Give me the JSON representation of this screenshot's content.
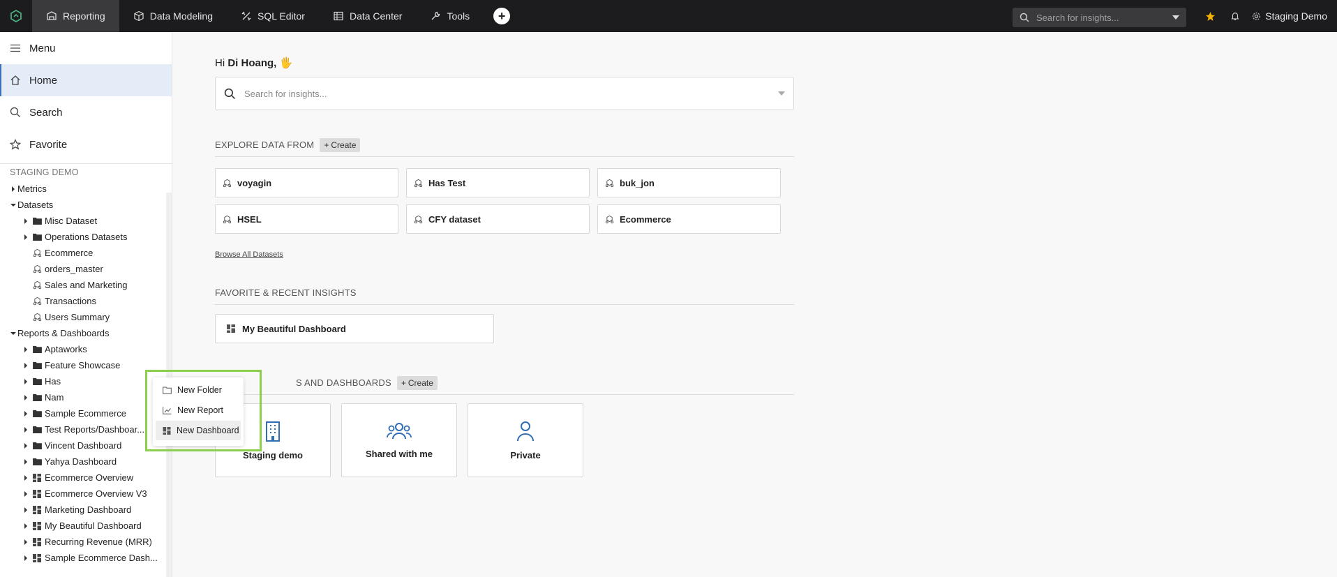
{
  "topbar": {
    "nav": [
      {
        "label": "Reporting",
        "icon": "reporting-icon",
        "active": true
      },
      {
        "label": "Data Modeling",
        "icon": "cube-icon"
      },
      {
        "label": "SQL Editor",
        "icon": "sql-icon"
      },
      {
        "label": "Data Center",
        "icon": "table-icon"
      },
      {
        "label": "Tools",
        "icon": "wrench-icon"
      }
    ],
    "search_placeholder": "Search for insights...",
    "workspace": "Staging Demo",
    "star_color": "#f5b400"
  },
  "sidebar": {
    "menu": "Menu",
    "home": "Home",
    "search": "Search",
    "favorite": "Favorite",
    "section": "STAGING DEMO",
    "tree": [
      {
        "label": "Metrics",
        "level": 0,
        "arrow": "right",
        "icon": "none"
      },
      {
        "label": "Datasets",
        "level": 0,
        "arrow": "down",
        "icon": "none"
      },
      {
        "label": "Misc Dataset",
        "level": 1,
        "arrow": "right",
        "icon": "folder"
      },
      {
        "label": "Operations Datasets",
        "level": 1,
        "arrow": "right",
        "icon": "folder"
      },
      {
        "label": "Ecommerce",
        "level": 1,
        "arrow": "none",
        "icon": "dataset"
      },
      {
        "label": "orders_master",
        "level": 1,
        "arrow": "none",
        "icon": "dataset"
      },
      {
        "label": "Sales and Marketing",
        "level": 1,
        "arrow": "none",
        "icon": "dataset"
      },
      {
        "label": "Transactions",
        "level": 1,
        "arrow": "none",
        "icon": "dataset"
      },
      {
        "label": "Users Summary",
        "level": 1,
        "arrow": "none",
        "icon": "dataset"
      },
      {
        "label": "Reports & Dashboards",
        "level": 0,
        "arrow": "down",
        "icon": "none"
      },
      {
        "label": "Aptaworks",
        "level": 1,
        "arrow": "right",
        "icon": "folder"
      },
      {
        "label": "Feature Showcase",
        "level": 1,
        "arrow": "right",
        "icon": "folder"
      },
      {
        "label": "Has",
        "level": 1,
        "arrow": "right",
        "icon": "folder"
      },
      {
        "label": "Nam",
        "level": 1,
        "arrow": "right",
        "icon": "folder"
      },
      {
        "label": "Sample Ecommerce",
        "level": 1,
        "arrow": "right",
        "icon": "folder"
      },
      {
        "label": "Test Reports/Dashboar...",
        "level": 1,
        "arrow": "right",
        "icon": "folder"
      },
      {
        "label": "Vincent Dashboard",
        "level": 1,
        "arrow": "right",
        "icon": "folder"
      },
      {
        "label": "Yahya Dashboard",
        "level": 1,
        "arrow": "right",
        "icon": "folder"
      },
      {
        "label": "Ecommerce Overview",
        "level": 1,
        "arrow": "right",
        "icon": "dashboard"
      },
      {
        "label": "Ecommerce Overview V3",
        "level": 1,
        "arrow": "right",
        "icon": "dashboard"
      },
      {
        "label": "Marketing Dashboard",
        "level": 1,
        "arrow": "right",
        "icon": "dashboard"
      },
      {
        "label": "My Beautiful Dashboard",
        "level": 1,
        "arrow": "right",
        "icon": "dashboard"
      },
      {
        "label": "Recurring Revenue (MRR)",
        "level": 1,
        "arrow": "right",
        "icon": "dashboard"
      },
      {
        "label": "Sample Ecommerce Dash...",
        "level": 1,
        "arrow": "right",
        "icon": "dashboard"
      }
    ]
  },
  "main": {
    "greeting_prefix": "Hi ",
    "user_name": "Di Hoang,",
    "wave": "🖐",
    "search_placeholder": "Search for insights...",
    "explore": {
      "title": "EXPLORE DATA FROM",
      "create": "Create",
      "datasets": [
        "voyagin",
        "Has Test",
        "buk_jon",
        "HSEL",
        "CFY dataset",
        "Ecommerce"
      ],
      "browse": "Browse All Datasets"
    },
    "favorites": {
      "title": "FAVORITE & RECENT INSIGHTS",
      "items": [
        "My Beautiful Dashboard"
      ]
    },
    "reports": {
      "title": "S AND DASHBOARDS",
      "create": "Create",
      "folders": [
        {
          "label": "Staging demo",
          "icon": "building-icon"
        },
        {
          "label": "Shared with me",
          "icon": "users-icon"
        },
        {
          "label": "Private",
          "icon": "user-icon"
        }
      ]
    }
  },
  "context_menu": {
    "items": [
      {
        "label": "New Folder",
        "icon": "folder-outline-icon"
      },
      {
        "label": "New Report",
        "icon": "chart-icon"
      },
      {
        "label": "New Dashboard",
        "icon": "dashboard-icon",
        "hovered": true
      }
    ],
    "highlight_color": "#8ccf4d",
    "accent_color": "#3b6fb6"
  }
}
